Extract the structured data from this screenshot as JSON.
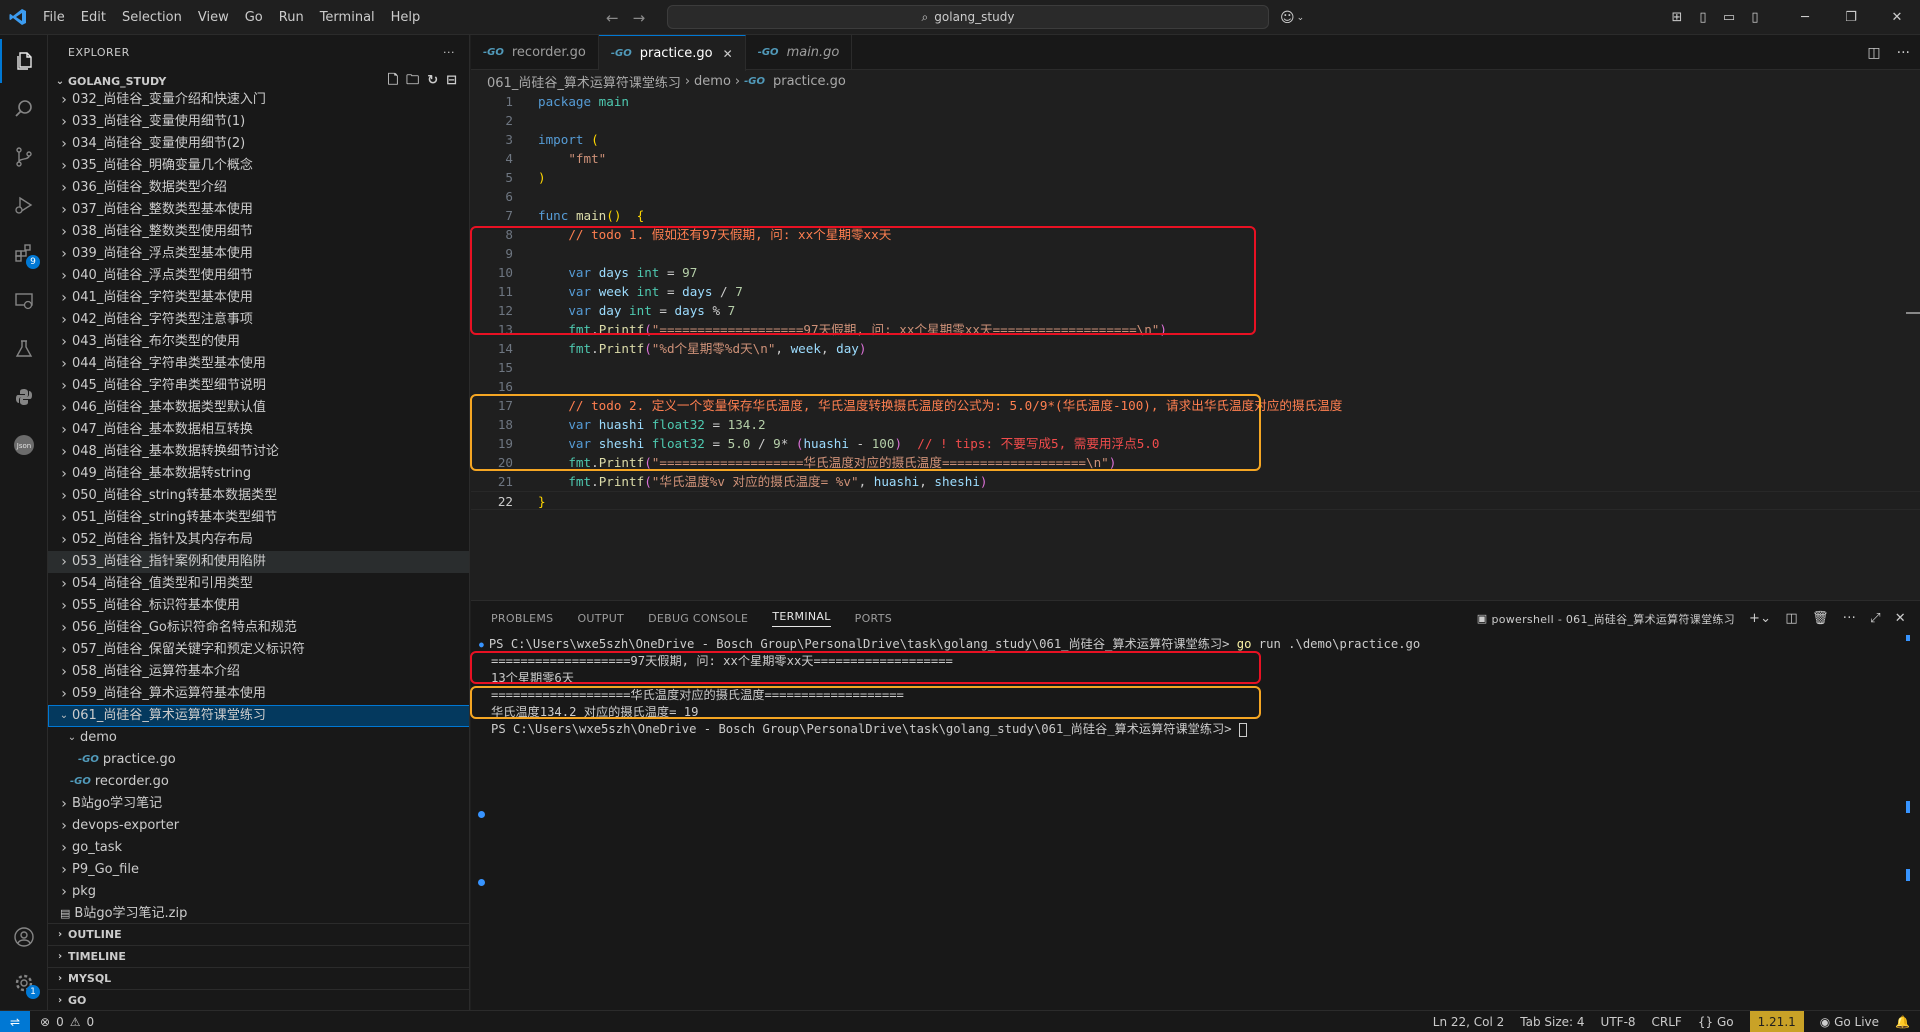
{
  "titlebar": {
    "menu": [
      "File",
      "Edit",
      "Selection",
      "View",
      "Go",
      "Run",
      "Terminal",
      "Help"
    ],
    "search_text": "golang_study"
  },
  "activity_bar": {
    "extensions_badge": "9",
    "settings_badge": "1"
  },
  "explorer": {
    "title": "EXPLORER",
    "root": "GOLANG_STUDY",
    "items": [
      {
        "label": "032_尚硅谷_变量介绍和快速入门",
        "depth": 0,
        "type": "folder"
      },
      {
        "label": "033_尚硅谷_变量使用细节(1)",
        "depth": 0,
        "type": "folder"
      },
      {
        "label": "034_尚硅谷_变量使用细节(2)",
        "depth": 0,
        "type": "folder"
      },
      {
        "label": "035_尚硅谷_明确变量几个概念",
        "depth": 0,
        "type": "folder"
      },
      {
        "label": "036_尚硅谷_数据类型介绍",
        "depth": 0,
        "type": "folder"
      },
      {
        "label": "037_尚硅谷_整数类型基本使用",
        "depth": 0,
        "type": "folder"
      },
      {
        "label": "038_尚硅谷_整数类型使用细节",
        "depth": 0,
        "type": "folder"
      },
      {
        "label": "039_尚硅谷_浮点类型基本使用",
        "depth": 0,
        "type": "folder"
      },
      {
        "label": "040_尚硅谷_浮点类型使用细节",
        "depth": 0,
        "type": "folder"
      },
      {
        "label": "041_尚硅谷_字符类型基本使用",
        "depth": 0,
        "type": "folder"
      },
      {
        "label": "042_尚硅谷_字符类型注意事项",
        "depth": 0,
        "type": "folder"
      },
      {
        "label": "043_尚硅谷_布尔类型的使用",
        "depth": 0,
        "type": "folder"
      },
      {
        "label": "044_尚硅谷_字符串类型基本使用",
        "depth": 0,
        "type": "folder"
      },
      {
        "label": "045_尚硅谷_字符串类型细节说明",
        "depth": 0,
        "type": "folder"
      },
      {
        "label": "046_尚硅谷_基本数据类型默认值",
        "depth": 0,
        "type": "folder"
      },
      {
        "label": "047_尚硅谷_基本数据相互转换",
        "depth": 0,
        "type": "folder"
      },
      {
        "label": "048_尚硅谷_基本数据转换细节讨论",
        "depth": 0,
        "type": "folder"
      },
      {
        "label": "049_尚硅谷_基本数据转string",
        "depth": 0,
        "type": "folder"
      },
      {
        "label": "050_尚硅谷_string转基本数据类型",
        "depth": 0,
        "type": "folder"
      },
      {
        "label": "051_尚硅谷_string转基本类型细节",
        "depth": 0,
        "type": "folder"
      },
      {
        "label": "052_尚硅谷_指针及其内存布局",
        "depth": 0,
        "type": "folder"
      },
      {
        "label": "053_尚硅谷_指针案例和使用陷阱",
        "depth": 0,
        "type": "folder",
        "state": "hover"
      },
      {
        "label": "054_尚硅谷_值类型和引用类型",
        "depth": 0,
        "type": "folder"
      },
      {
        "label": "055_尚硅谷_标识符基本使用",
        "depth": 0,
        "type": "folder"
      },
      {
        "label": "056_尚硅谷_Go标识符命名特点和规范",
        "depth": 0,
        "type": "folder"
      },
      {
        "label": "057_尚硅谷_保留关键字和预定义标识符",
        "depth": 0,
        "type": "folder"
      },
      {
        "label": "058_尚硅谷_运算符基本介绍",
        "depth": 0,
        "type": "folder"
      },
      {
        "label": "059_尚硅谷_算术运算符基本使用",
        "depth": 0,
        "type": "folder"
      },
      {
        "label": "061_尚硅谷_算术运算符课堂练习",
        "depth": 0,
        "type": "folder-open",
        "state": "selected"
      },
      {
        "label": "demo",
        "depth": 1,
        "type": "folder-open"
      },
      {
        "label": "practice.go",
        "depth": 2,
        "type": "go"
      },
      {
        "label": "recorder.go",
        "depth": 1,
        "type": "go"
      },
      {
        "label": "B站go学习笔记",
        "depth": 0,
        "type": "folder"
      },
      {
        "label": "devops-exporter",
        "depth": 0,
        "type": "folder"
      },
      {
        "label": "go_task",
        "depth": 0,
        "type": "folder"
      },
      {
        "label": "P9_Go_file",
        "depth": 0,
        "type": "folder"
      },
      {
        "label": "pkg",
        "depth": 0,
        "type": "folder"
      },
      {
        "label": "B站go学习笔记.zip",
        "depth": 0,
        "type": "zip"
      }
    ],
    "sections": [
      "OUTLINE",
      "TIMELINE",
      "MYSQL",
      "GO"
    ]
  },
  "tabs": [
    {
      "label": "recorder.go",
      "active": false,
      "italic": false
    },
    {
      "label": "practice.go",
      "active": true,
      "italic": false
    },
    {
      "label": "main.go",
      "active": false,
      "italic": true
    }
  ],
  "breadcrumbs": [
    "061_尚硅谷_算术运算符课堂练习",
    "demo",
    "practice.go"
  ],
  "code": {
    "line_numbers": [
      "1",
      "2",
      "3",
      "4",
      "5",
      "6",
      "7",
      "8",
      "9",
      "10",
      "11",
      "12",
      "13",
      "14",
      "15",
      "16",
      "17",
      "18",
      "19",
      "20",
      "21",
      "22"
    ],
    "current_line": "22",
    "l1_kw": "package",
    "l1_name": "main",
    "l3_kw": "import",
    "l3_paren": "(",
    "l4_str": "\"fmt\"",
    "l5_paren": ")",
    "l7_kw": "func",
    "l7_fn": "main",
    "l7_rest": "()  {",
    "l8_comment": "// todo 1. 假如还有97天假期, 问: xx个星期零xx天",
    "l10_var": "days",
    "l10_type": "int",
    "l10_val": "97",
    "l11_var": "week",
    "l11_type": "int",
    "l11_expr_var": "days",
    "l11_op": " / ",
    "l11_num": "7",
    "l12_var": "day",
    "l12_type": "int",
    "l12_expr_var": "days",
    "l12_op": " % ",
    "l12_num": "7",
    "l13_pkg": "fmt",
    "l13_fn": "Printf",
    "l13_str": "\"===================97天假期, 问: xx个星期零xx天===================\\n\"",
    "l14_pkg": "fmt",
    "l14_fn": "Printf",
    "l14_str": "\"%d个星期零%d天\\n\"",
    "l14_args_a": "week",
    "l14_args_b": "day",
    "l17_comment": "// todo 2. 定义一个变量保存华氏温度, 华氏温度转换摄氏温度的公式为: 5.0/9*(华氏温度-100), 请求出华氏温度对应的摄氏温度",
    "l18_var": "huashi",
    "l18_type": "float32",
    "l18_val": "134.2",
    "l19_var": "sheshi",
    "l19_type": "float32",
    "l19_a": "5.0",
    "l19_b": "9",
    "l19_c": "huashi",
    "l19_d": "100",
    "l19_comment": "// ! tips: 不要写成5, 需要用浮点5.0",
    "l20_pkg": "fmt",
    "l20_fn": "Printf",
    "l20_str": "\"===================华氏温度对应的摄氏温度===================\\n\"",
    "l21_pkg": "fmt",
    "l21_fn": "Printf",
    "l21_str": "\"华氏温度%v 对应的摄氏温度= %v\"",
    "l21_args_a": "huashi",
    "l21_args_b": "sheshi",
    "l22_brace": "}"
  },
  "panel": {
    "tabs": [
      "PROBLEMS",
      "OUTPUT",
      "DEBUG CONSOLE",
      "TERMINAL",
      "PORTS"
    ],
    "active_tab": "TERMINAL",
    "terminal_name": "powershell - 061_尚硅谷_算术运算符课堂练习",
    "terminal": {
      "prompt1": "PS C:\\Users\\wxe5szh\\OneDrive - Bosch Group\\PersonalDrive\\task\\golang_study\\061_尚硅谷_算术运算符课堂练习> ",
      "cmd1_go": "go",
      "cmd1_rest": " run .\\demo\\practice.go",
      "out1": "===================97天假期, 问: xx个星期零xx天===================",
      "out2": "13个星期零6天",
      "out3": "===================华氏温度对应的摄氏温度===================",
      "out4": "华氏温度134.2 对应的摄氏温度= 19",
      "prompt2": "PS C:\\Users\\wxe5szh\\OneDrive - Bosch Group\\PersonalDrive\\task\\golang_study\\061_尚硅谷_算术运算符课堂练习> "
    }
  },
  "status": {
    "errors": "0",
    "warnings": "0",
    "position": "Ln 22, Col 2",
    "tab_size": "Tab Size: 4",
    "encoding": "UTF-8",
    "eol": "CRLF",
    "language": "Go",
    "go_version": "1.21.1",
    "go_live": "Go Live"
  }
}
